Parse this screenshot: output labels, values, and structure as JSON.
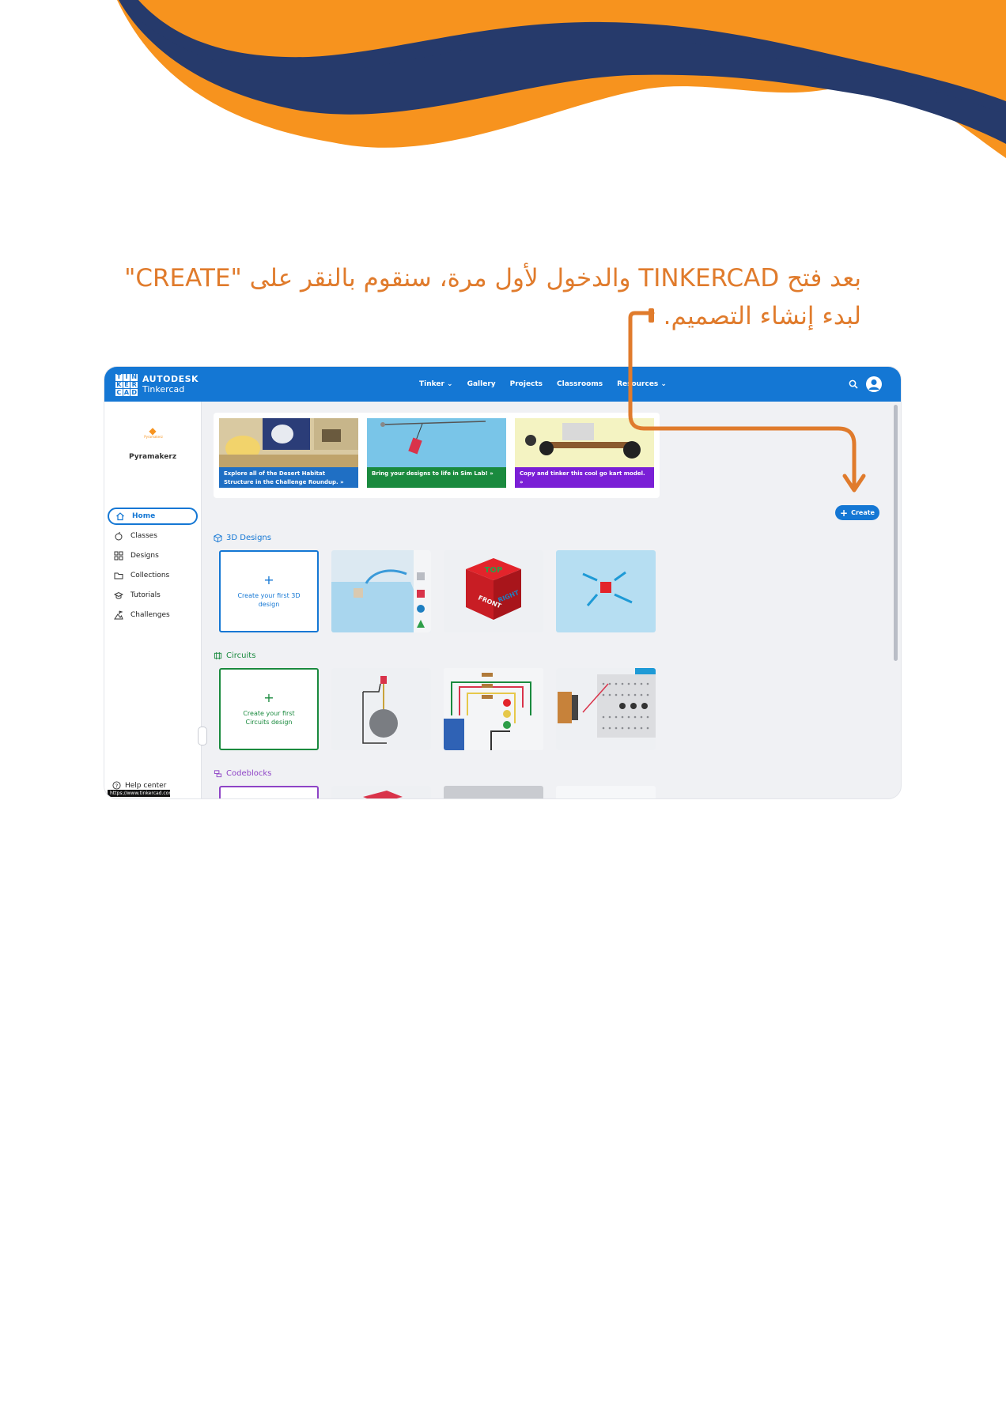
{
  "instruction": {
    "line1": "بعد فتح TINKERCAD والدخول لأول مرة، سنقوم بالنقر على \"CREATE\"",
    "line2": "لبدء إنشاء التصميم."
  },
  "colors": {
    "orange": "#f7931e",
    "navy": "#263a6b",
    "accent": "#1477d4",
    "annotation": "#e07b2c"
  },
  "app": {
    "logo_letters": [
      "T",
      "I",
      "N",
      "K",
      "E",
      "R",
      "C",
      "A",
      "D"
    ],
    "brand_line1": "AUTODESK",
    "brand_line2": "Tinkercad",
    "nav": [
      "Tinker ⌄",
      "Gallery",
      "Projects",
      "Classrooms",
      "Resources ⌄"
    ],
    "header_icons": [
      "search-icon",
      "user-avatar-icon"
    ]
  },
  "sidebar": {
    "org_logo_text": "Pyramakerz",
    "org_name": "Pyramakerz",
    "items": [
      {
        "label": "Home",
        "icon": "home-icon"
      },
      {
        "label": "Classes",
        "icon": "apple-icon"
      },
      {
        "label": "Designs",
        "icon": "grid-icon"
      },
      {
        "label": "Collections",
        "icon": "folder-icon"
      },
      {
        "label": "Tutorials",
        "icon": "graduation-cap-icon"
      },
      {
        "label": "Challenges",
        "icon": "mountain-flag-icon"
      }
    ],
    "help": "Help center",
    "url_tooltip": "https://www.tinkercad.com"
  },
  "banners": [
    {
      "caption": "Explore all of the Desert Habitat Structure in the Challenge Roundup. »",
      "color": "#1f6fc4"
    },
    {
      "caption": "Bring your designs to life in Sim Lab! »",
      "color": "#1a8a3e"
    },
    {
      "caption": "Copy and tinker this cool go kart model. »",
      "color": "#7a1fd6"
    }
  ],
  "create_button": "Create",
  "sections": {
    "designs": {
      "title": "3D Designs",
      "create_text": "Create your first 3D design",
      "color": "#1477d4"
    },
    "circuits": {
      "title": "Circuits",
      "create_text": "Create your first Circuits design",
      "color": "#1a8a3e"
    },
    "codeblocks": {
      "title": "Codeblocks",
      "color": "#8e44c6"
    }
  },
  "cube_labels": [
    "TOP",
    "FRONT",
    "RIGHT"
  ]
}
